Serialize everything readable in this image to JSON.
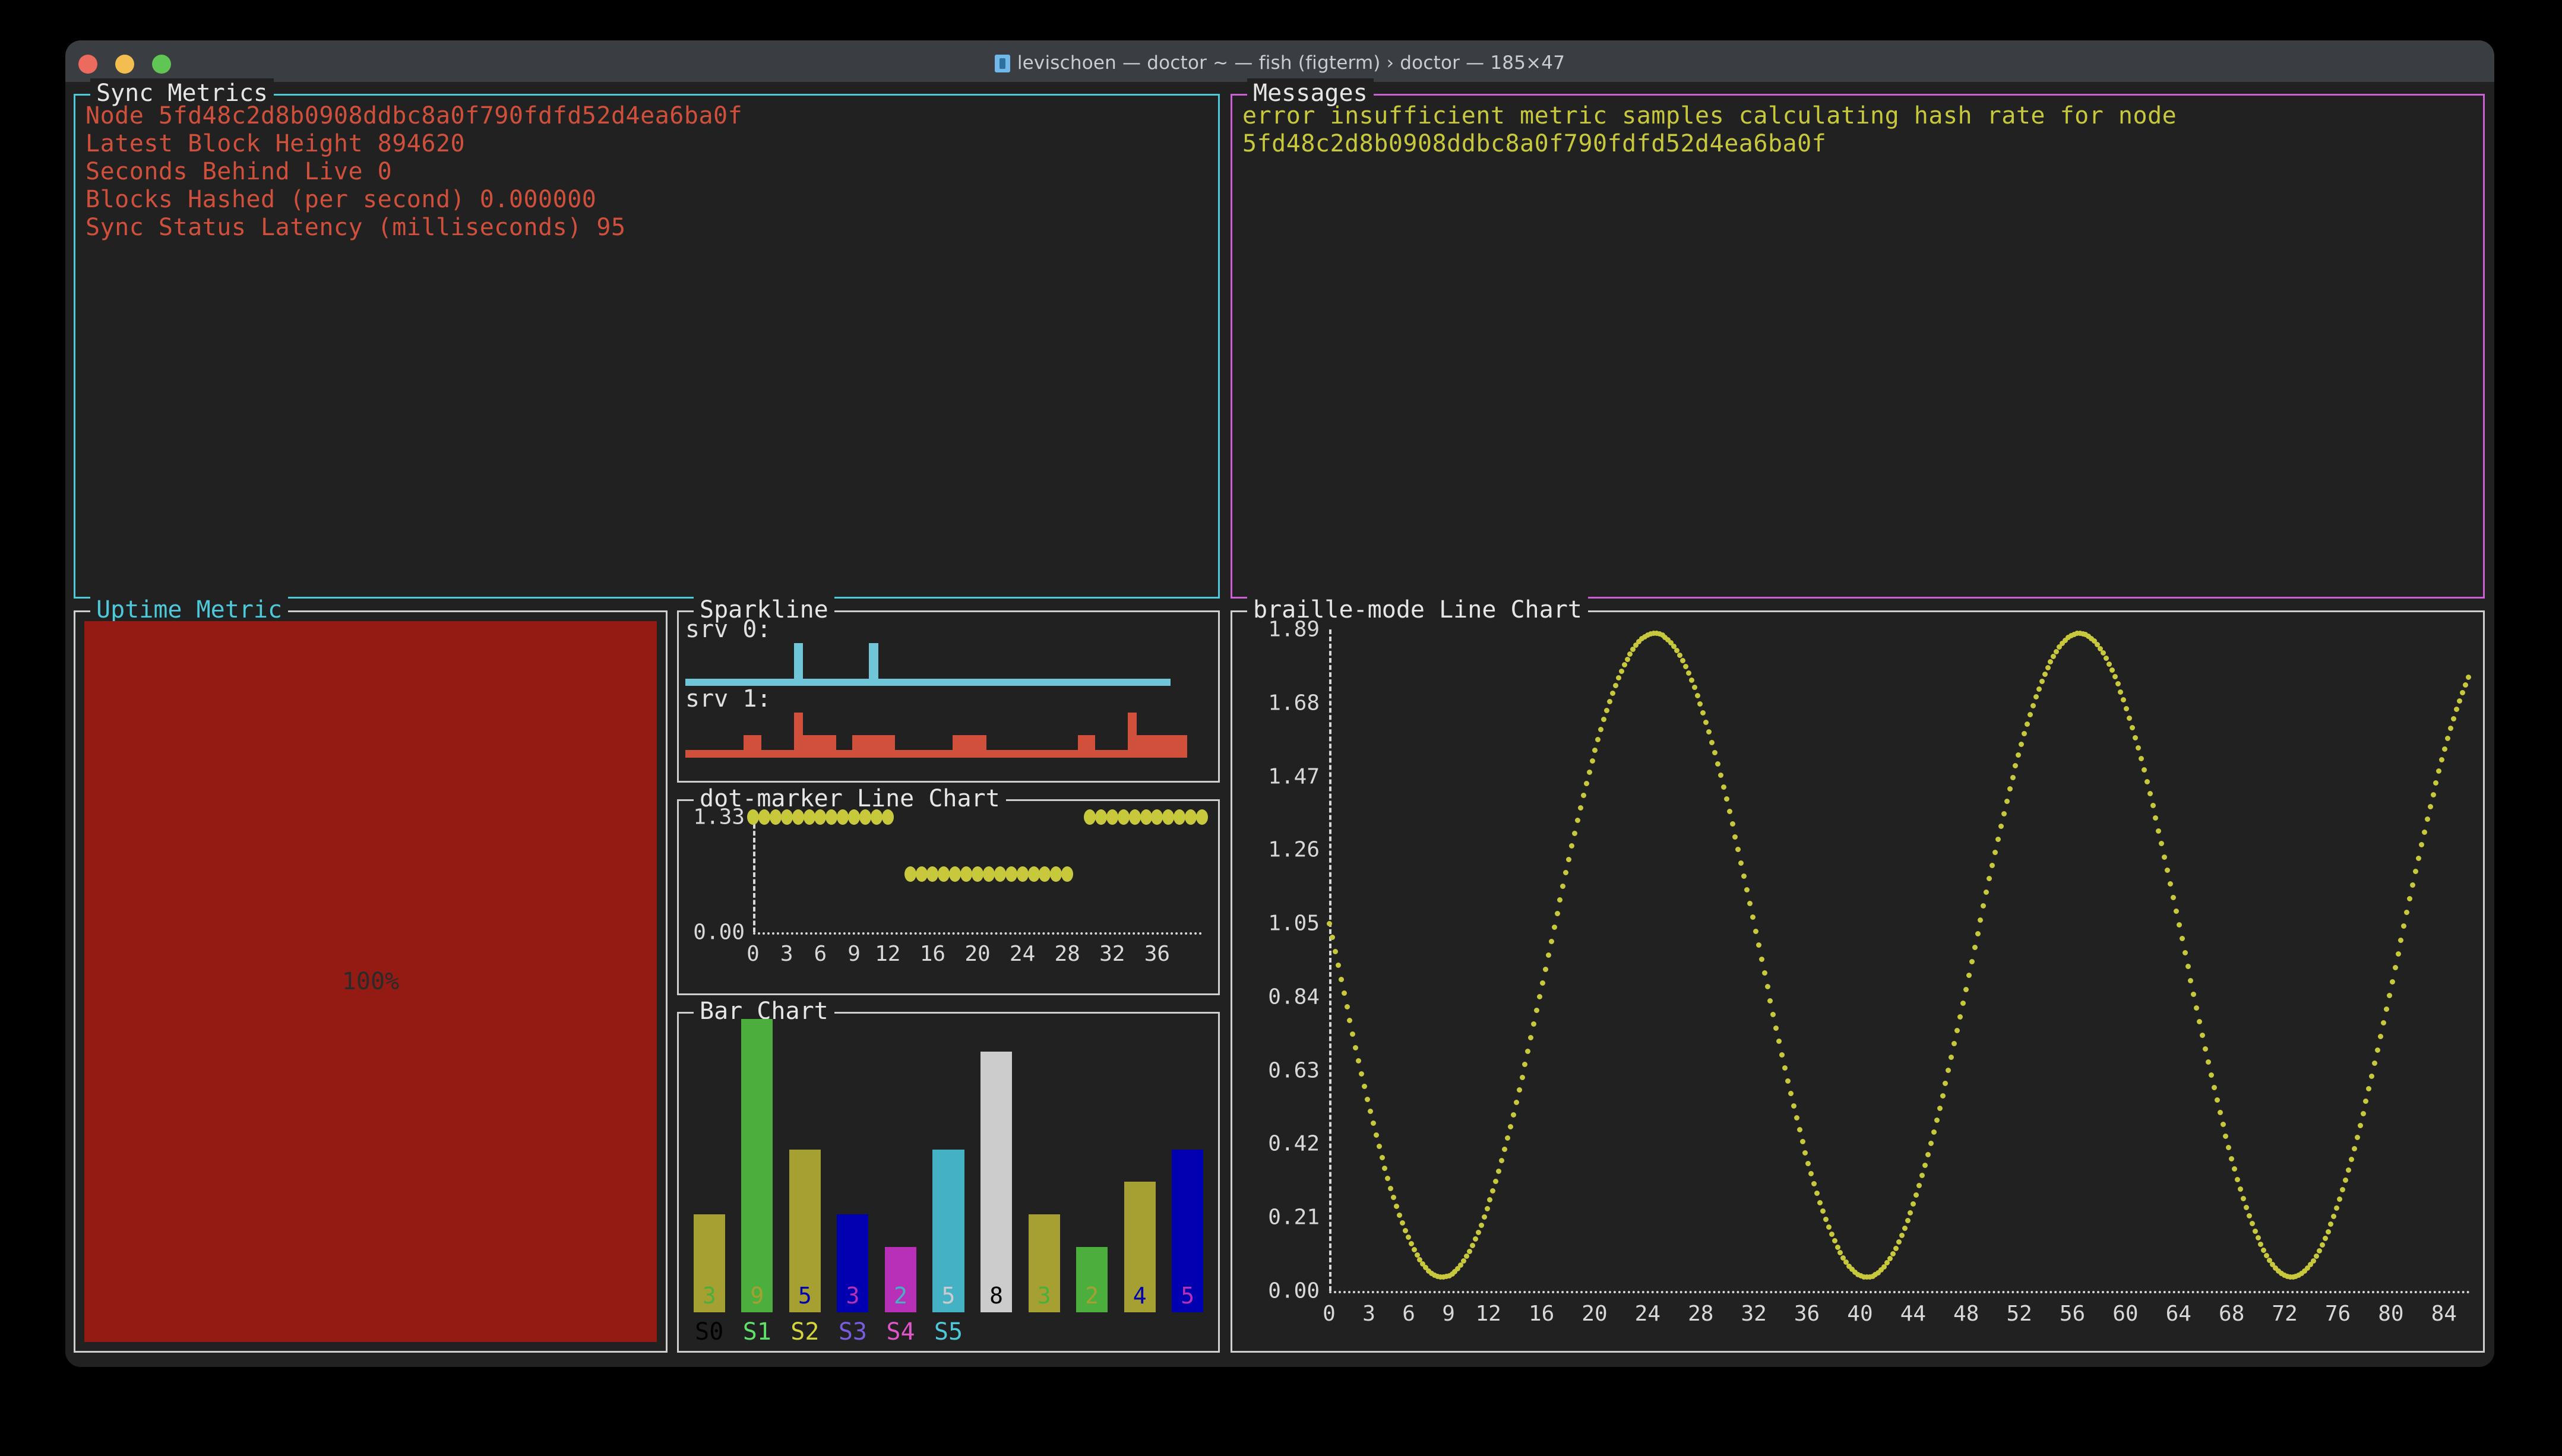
{
  "window": {
    "title": "levischoen — doctor ~ — fish (figterm) › doctor — 185×47",
    "traffic_lights": [
      "close",
      "minimize",
      "zoom"
    ],
    "colors": {
      "titlebar": "#3a3d42",
      "terminal_bg": "#212121",
      "red": "#ec6a5e",
      "yellow": "#f4bd4f",
      "green": "#61c554"
    }
  },
  "sync_metrics": {
    "title": "Sync Metrics",
    "border_color": "#4ec9d9",
    "text_color": "#d0503c",
    "lines": [
      "Node 5fd48c2d8b0908ddbc8a0f790fdfd52d4ea6ba0f",
      "Latest Block Height 894620",
      "Seconds Behind Live 0",
      "Blocks Hashed (per second) 0.000000",
      "Sync Status Latency (milliseconds) 95"
    ]
  },
  "messages": {
    "title": "Messages",
    "border_color": "#cc5fd6",
    "text_color": "#c8c83c",
    "lines": [
      "error insufficient metric samples calculating hash rate for node",
      "5fd48c2d8b0908ddbc8a0f790fdfd52d4ea6ba0f"
    ]
  },
  "uptime_metric": {
    "title": "Uptime Metric",
    "title_color": "#4ec9d9",
    "border_color": "#cfcfcf",
    "value_label": "100%",
    "percent": 100,
    "fill_color": "#941b13",
    "label_color": "#2a2a2a"
  },
  "sparkline": {
    "title": "Sparkline",
    "series": [
      {
        "name": "srv 0:",
        "color": "#6ec6d8",
        "max": 6,
        "values": [
          1,
          1,
          1,
          1,
          1,
          1,
          1,
          1,
          1,
          1,
          1,
          1,
          1,
          6,
          1,
          1,
          1,
          1,
          1,
          1,
          1,
          1,
          6,
          1,
          1,
          1,
          1,
          1,
          1,
          1,
          1,
          1,
          1,
          1,
          1,
          1,
          1,
          1,
          1,
          1,
          1,
          1,
          1,
          1,
          1,
          1,
          1,
          1,
          1,
          1,
          1,
          1,
          1,
          1,
          1,
          1,
          1,
          1,
          0,
          0,
          0,
          0,
          0
        ]
      },
      {
        "name": "srv 1:",
        "color": "#d0503c",
        "max": 6,
        "values": [
          1,
          1,
          1,
          1,
          1,
          1,
          1,
          3,
          3,
          1,
          1,
          1,
          1,
          6,
          3,
          3,
          3,
          3,
          1,
          1,
          3,
          3,
          3,
          3,
          3,
          1,
          1,
          1,
          1,
          1,
          1,
          1,
          3,
          3,
          3,
          3,
          1,
          1,
          1,
          1,
          1,
          1,
          1,
          1,
          1,
          1,
          1,
          3,
          3,
          1,
          1,
          1,
          1,
          6,
          3,
          3,
          3,
          3,
          3,
          3,
          0,
          0,
          0
        ]
      }
    ]
  },
  "chart_data": [
    {
      "type": "line",
      "title": "dot-marker Line Chart",
      "marker": "dot",
      "color": "#c8c83c",
      "ylabel": "",
      "xlabel": "",
      "ylim": [
        0.0,
        1.33
      ],
      "xlim": [
        0,
        40
      ],
      "yticks": [
        "0.00",
        "1.33"
      ],
      "ytick_values": [
        0.0,
        1.33
      ],
      "xticks": [
        "0",
        "3",
        "6",
        "9",
        "12",
        "16",
        "20",
        "24",
        "28",
        "32",
        "36"
      ],
      "xtick_values": [
        0,
        3,
        6,
        9,
        12,
        16,
        20,
        24,
        28,
        32,
        36
      ],
      "grid": false,
      "x": [
        0,
        1,
        2,
        3,
        4,
        5,
        6,
        7,
        8,
        9,
        10,
        11,
        12,
        14,
        15,
        16,
        17,
        18,
        19,
        20,
        21,
        22,
        23,
        24,
        25,
        26,
        27,
        28,
        30,
        31,
        32,
        33,
        34,
        35,
        36,
        37,
        38,
        39,
        40
      ],
      "values": [
        1.33,
        1.33,
        1.33,
        1.33,
        1.33,
        1.33,
        1.33,
        1.33,
        1.33,
        1.33,
        1.33,
        1.33,
        1.33,
        0.67,
        0.67,
        0.67,
        0.67,
        0.67,
        0.67,
        0.67,
        0.67,
        0.67,
        0.67,
        0.67,
        0.67,
        0.67,
        0.67,
        0.67,
        1.33,
        1.33,
        1.33,
        1.33,
        1.33,
        1.33,
        1.33,
        1.33,
        1.33,
        1.33,
        1.33
      ]
    },
    {
      "type": "bar",
      "title": "Bar Chart",
      "categories": [
        "S0",
        "S1",
        "S2",
        "S3",
        "S4",
        "S5",
        "",
        "",
        "",
        "",
        ""
      ],
      "values": [
        3,
        9,
        5,
        3,
        2,
        5,
        8,
        3,
        2,
        4,
        5
      ],
      "ylim": [
        0,
        9
      ],
      "bar_colors": [
        "#a6a033",
        "#4caf3d",
        "#a6a033",
        "#0000b0",
        "#b830b8",
        "#45b1c4",
        "#cccccc",
        "#a6a033",
        "#4caf3d",
        "#a6a033",
        "#0000b0"
      ],
      "value_label_colors": [
        "#4caf3d",
        "#a6a033",
        "#0000b0",
        "#b830b8",
        "#45b1c4",
        "#cccccc",
        "#000000",
        "#4caf3d",
        "#a6a033",
        "#0000b0",
        "#b830b8"
      ],
      "label_colors": [
        "#000000",
        "#5ee06a",
        "#d4d43c",
        "#7a5ce0",
        "#e055c8",
        "#4ec9d9",
        "",
        "",
        "",
        "",
        ""
      ],
      "grid": false
    },
    {
      "type": "line",
      "title": "braille-mode Line Chart",
      "marker": "braille",
      "color": "#c8c83c",
      "ylim": [
        0.0,
        1.89
      ],
      "xlim": [
        0,
        86
      ],
      "yticks": [
        "0.00",
        "0.21",
        "0.42",
        "0.63",
        "0.84",
        "1.05",
        "1.26",
        "1.47",
        "1.68",
        "1.89"
      ],
      "ytick_values": [
        0.0,
        0.21,
        0.42,
        0.63,
        0.84,
        1.05,
        1.26,
        1.47,
        1.68,
        1.89
      ],
      "xticks": [
        "0",
        "3",
        "6",
        "9",
        "12",
        "16",
        "20",
        "24",
        "28",
        "32",
        "36",
        "40",
        "44",
        "48",
        "52",
        "56",
        "60",
        "64",
        "68",
        "72",
        "76",
        "80",
        "84"
      ],
      "xtick_values": [
        0,
        3,
        6,
        9,
        12,
        16,
        20,
        24,
        28,
        32,
        36,
        40,
        44,
        48,
        52,
        56,
        60,
        64,
        68,
        72,
        76,
        80,
        84
      ],
      "grid": false,
      "description": "sinusoid, amplitude 0.95 about mean 0.96, period 32 units, starting near 1.15 and descending",
      "wave": {
        "mean": 0.96,
        "amplitude": 0.92,
        "period": 32.0,
        "phase_x": 24.5
      }
    }
  ]
}
